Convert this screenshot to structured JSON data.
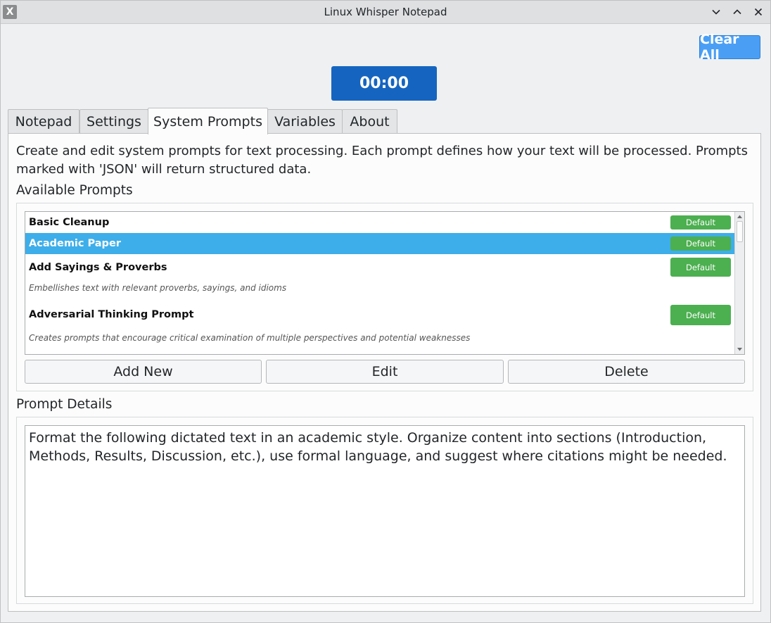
{
  "window": {
    "title": "Linux Whisper Notepad",
    "app_icon_glyph": "X"
  },
  "toolbar": {
    "clear_all_label": "Clear All",
    "timer": "00:00"
  },
  "tabs": [
    {
      "label": "Notepad",
      "active": false
    },
    {
      "label": "Settings",
      "active": false
    },
    {
      "label": "System Prompts",
      "active": true
    },
    {
      "label": "Variables",
      "active": false
    },
    {
      "label": "About",
      "active": false
    }
  ],
  "system_prompts": {
    "description": "Create and edit system prompts for text processing. Each prompt defines how your text will be processed. Prompts marked with 'JSON' will return structured data.",
    "available_label": "Available Prompts",
    "prompts": [
      {
        "name": "Basic Cleanup",
        "badge": "Default",
        "description": "",
        "selected": false
      },
      {
        "name": "Academic Paper",
        "badge": "Default",
        "description": "",
        "selected": true
      },
      {
        "name": "Add Sayings & Proverbs",
        "badge": "Default",
        "description": "Embellishes text with relevant proverbs, sayings, and idioms",
        "selected": false
      },
      {
        "name": "Adversarial Thinking Prompt",
        "badge": "Default",
        "description": "Creates prompts that encourage critical examination of multiple perspectives and potential weaknesses",
        "selected": false
      }
    ],
    "buttons": {
      "add_new": "Add New",
      "edit": "Edit",
      "delete": "Delete"
    },
    "details_label": "Prompt Details",
    "details_text": "Format the following dictated text in an academic style. Organize content into sections (Introduction, Methods, Results, Discussion, etc.), use formal language, and suggest where citations might be needed."
  },
  "colors": {
    "timer_bg": "#1565c0",
    "clear_all_bg": "#4a9ff5",
    "selection": "#3daee9",
    "badge": "#4caf50"
  }
}
